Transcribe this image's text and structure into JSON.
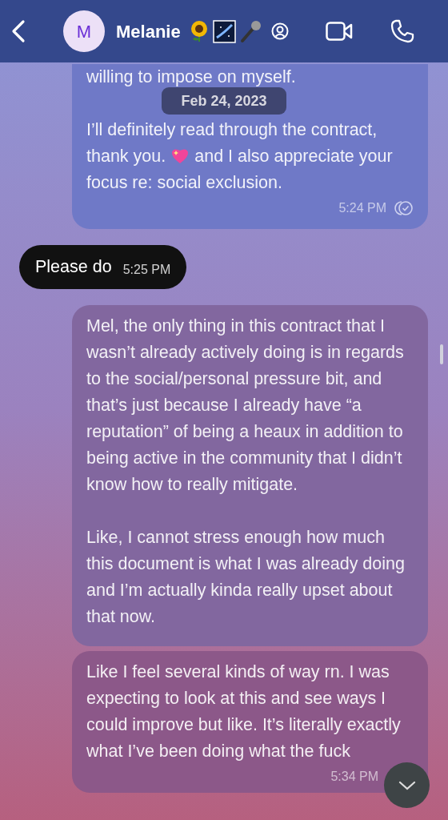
{
  "header": {
    "avatar_letter": "M",
    "name": "Melanie"
  },
  "messages": [
    {
      "kind": "sent",
      "paragraphs": [
        {
          "text": "willing to impose on myself."
        },
        {
          "text_before": "I’ll definitely read through the contract, thank you.",
          "text_after": "and I also appreciate your focus re: social exclusion."
        }
      ],
      "time": "5:24 PM",
      "read": true,
      "date_pill": "Feb 24, 2023"
    },
    {
      "kind": "received",
      "paragraphs": [
        {
          "text": "Please do"
        }
      ],
      "time": "5:25 PM"
    },
    {
      "kind": "sent",
      "paragraphs": [
        {
          "text": "Mel, the only thing in this contract that I wasn’t already actively doing is in regards to the social/personal pressure bit, and that’s just because I already have “a reputation” of being a heaux in addition to being active in the community that I didn’t know how to really mitigate."
        },
        {
          "text": "Like, I cannot stress enough how much this document is what I was already doing and I’m actually kinda really upset about that now."
        }
      ]
    },
    {
      "kind": "sent",
      "paragraphs": [
        {
          "text": "Like I feel several kinds of way rn. I was expecting to look at this and see ways I could improve but like. It’s literally exactly what I’ve been doing what the fuck"
        }
      ],
      "time": "5:34 PM",
      "read": false
    }
  ]
}
